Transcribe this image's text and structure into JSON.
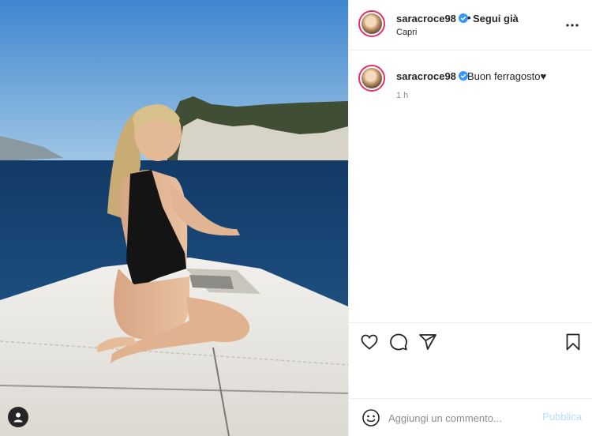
{
  "post": {
    "username": "saracroce98",
    "verified": true,
    "follow_label": "Segui già",
    "location": "Capri",
    "caption": "Buon ferragosto♥",
    "time_ago": "1 h"
  },
  "comment": {
    "placeholder": "Aggiungi un commento...",
    "publish_label": "Pubblica"
  },
  "icons": {
    "verified": "verified-badge-icon",
    "more": "more-options-icon",
    "like": "heart-icon",
    "comment": "comment-icon",
    "share": "share-icon",
    "save": "bookmark-icon",
    "emoji": "emoji-icon",
    "tag": "user-tag-icon"
  },
  "colors": {
    "verified": "#3897f0",
    "story_ring": "#e1306c",
    "publish_disabled": "#b2dffc"
  }
}
